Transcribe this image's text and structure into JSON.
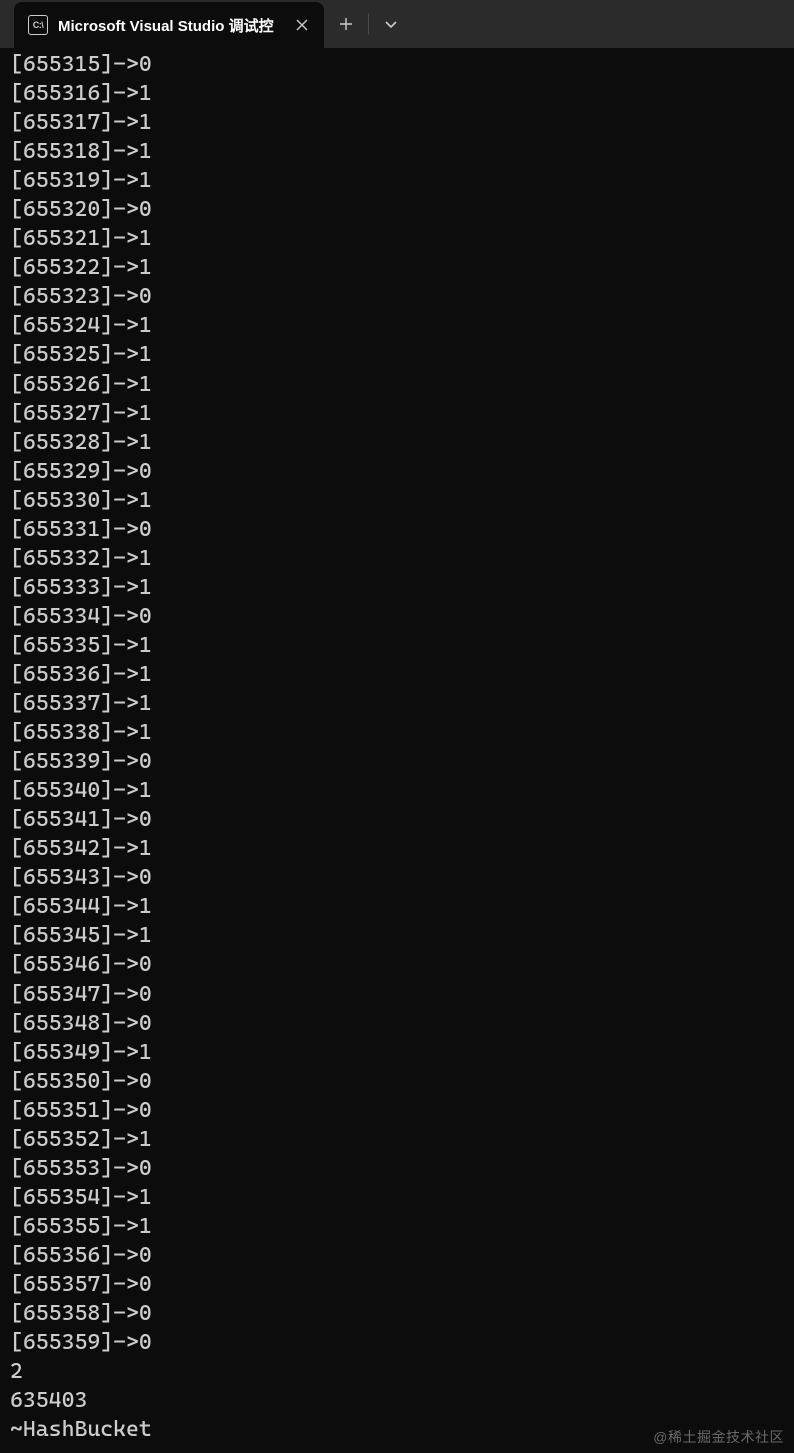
{
  "tab": {
    "title": "Microsoft Visual Studio 调试控",
    "icon_label": "C:\\"
  },
  "console": {
    "lines": [
      "[655315]->0",
      "[655316]->1",
      "[655317]->1",
      "[655318]->1",
      "[655319]->1",
      "[655320]->0",
      "[655321]->1",
      "[655322]->1",
      "[655323]->0",
      "[655324]->1",
      "[655325]->1",
      "[655326]->1",
      "[655327]->1",
      "[655328]->1",
      "[655329]->0",
      "[655330]->1",
      "[655331]->0",
      "[655332]->1",
      "[655333]->1",
      "[655334]->0",
      "[655335]->1",
      "[655336]->1",
      "[655337]->1",
      "[655338]->1",
      "[655339]->0",
      "[655340]->1",
      "[655341]->0",
      "[655342]->1",
      "[655343]->0",
      "[655344]->1",
      "[655345]->1",
      "[655346]->0",
      "[655347]->0",
      "[655348]->0",
      "[655349]->1",
      "[655350]->0",
      "[655351]->0",
      "[655352]->1",
      "[655353]->0",
      "[655354]->1",
      "[655355]->1",
      "[655356]->0",
      "[655357]->0",
      "[655358]->0",
      "[655359]->0",
      "2",
      "635403",
      "~HashBucket"
    ]
  },
  "watermark": "@稀土掘金技术社区"
}
